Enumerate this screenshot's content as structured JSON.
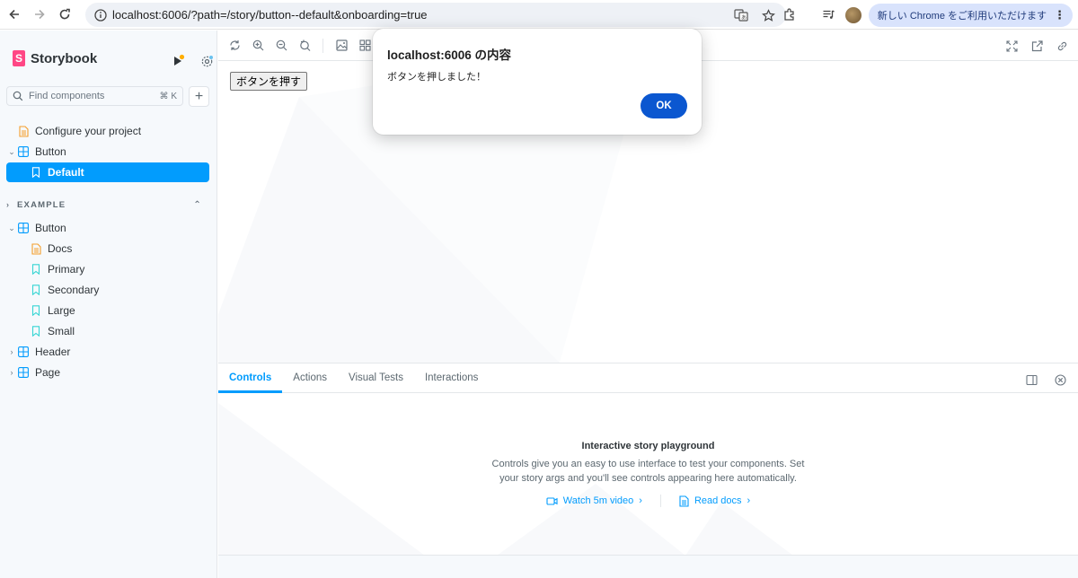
{
  "browser": {
    "url": "localhost:6006/?path=/story/button--default&onboarding=true",
    "new_chrome_label": "新しい Chrome をご利用いただけます"
  },
  "sidebar": {
    "brand": "Storybook",
    "search_placeholder": "Find components",
    "search_shortcut": "⌘ K",
    "top_items": [
      {
        "label": "Configure your project"
      },
      {
        "label": "Button"
      },
      {
        "label": "Default"
      }
    ],
    "section_title": "EXAMPLE",
    "example_items": [
      {
        "label": "Button"
      },
      {
        "label": "Docs"
      },
      {
        "label": "Primary"
      },
      {
        "label": "Secondary"
      },
      {
        "label": "Large"
      },
      {
        "label": "Small"
      },
      {
        "label": "Header"
      },
      {
        "label": "Page"
      }
    ]
  },
  "canvas": {
    "story_button_label": "ボタンを押す"
  },
  "panel": {
    "tabs": [
      "Controls",
      "Actions",
      "Visual Tests",
      "Interactions"
    ],
    "empty_title": "Interactive story playground",
    "empty_desc": "Controls give you an easy to use interface to test your components. Set your story args and you'll see controls appearing here automatically.",
    "watch_video": "Watch 5m video",
    "read_docs": "Read docs"
  },
  "dialog": {
    "title": "localhost:6006 の内容",
    "message": "ボタンを押しました！",
    "ok_label": "OK"
  },
  "colors": {
    "accent": "#029cfd",
    "brand_pink": "#ff4785",
    "dialog_button": "#0b57d0"
  }
}
